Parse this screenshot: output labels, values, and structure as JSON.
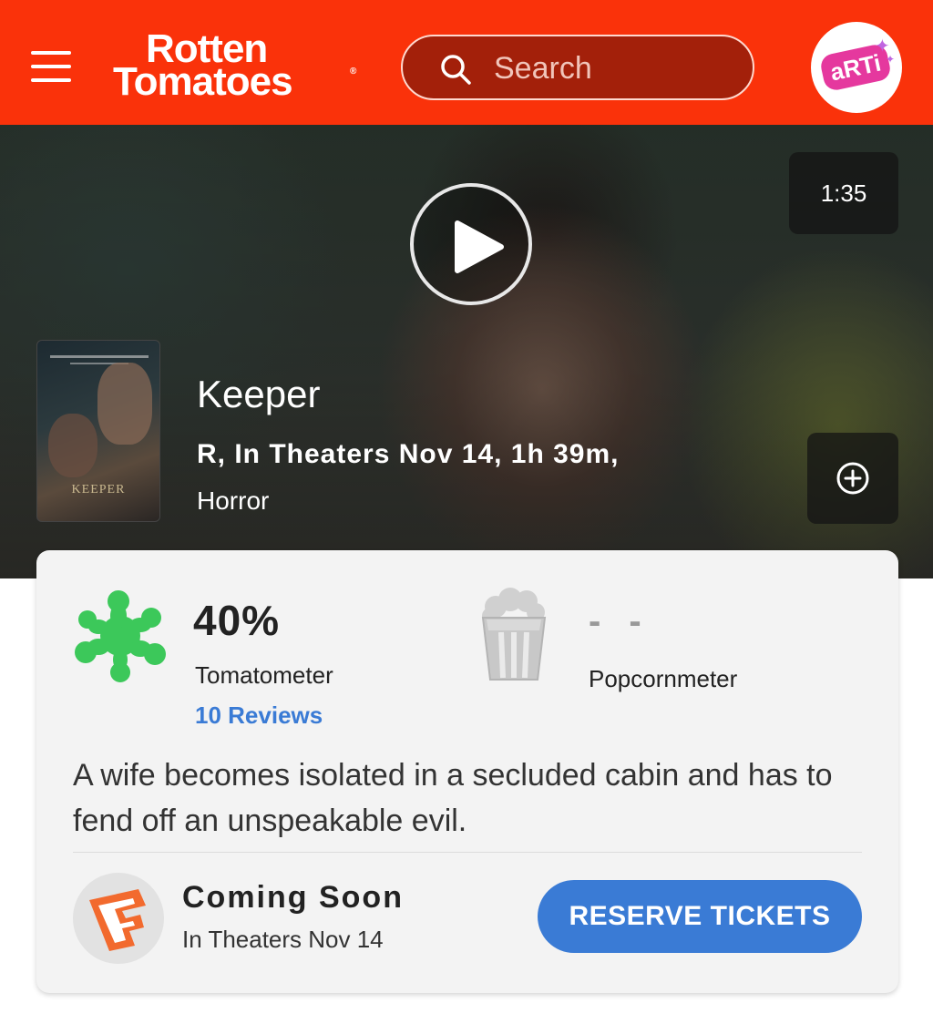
{
  "header": {
    "logo_line1": "Rotten",
    "logo_line2": "Tomatoes",
    "logo_mark": "®",
    "search_placeholder": "Search",
    "menu_icon": "hamburger-menu-icon",
    "search_icon": "search-icon",
    "profile_badge": "aRTi"
  },
  "hero": {
    "duration": "1:35",
    "play_icon": "play-icon",
    "poster_title": "KEEPER",
    "title": "Keeper",
    "meta": "R, In Theaters Nov 14, 1h 39m,",
    "genre": "Horror",
    "add_icon": "plus-circle-icon"
  },
  "scores": {
    "tomatometer_value": "40%",
    "tomatometer_label": "Tomatometer",
    "reviews_link": "10 Reviews",
    "popcornmeter_value": "- -",
    "popcornmeter_label": "Popcornmeter",
    "tomatometer_icon": "rotten-splat-icon",
    "popcornmeter_icon": "popcorn-bucket-icon"
  },
  "synopsis": "A wife becomes isolated in a secluded cabin and has to fend off an unspeakable evil.",
  "tickets": {
    "status_title": "Coming Soon",
    "status_sub": "In Theaters Nov 14",
    "button_label": "RESERVE TICKETS",
    "vendor_icon": "fandango-icon"
  },
  "colors": {
    "brand_red": "#fa320a",
    "splat_green": "#3cc85a",
    "link_blue": "#3a7bd5"
  }
}
